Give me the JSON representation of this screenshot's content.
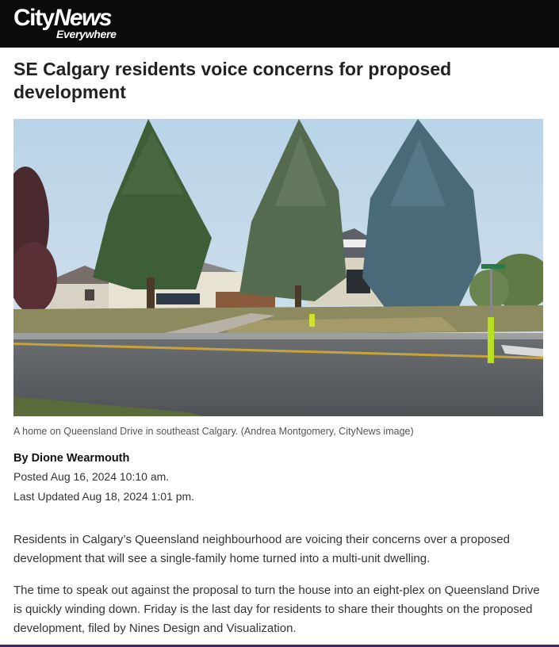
{
  "brand": {
    "name_part1": "City",
    "name_part2": "News",
    "tagline": "Everywhere"
  },
  "article": {
    "headline": "SE Calgary residents voice concerns for proposed development",
    "image_caption": "A home on Queensland Drive in southeast Calgary. (Andrea Montgomery, CityNews image)",
    "byline": "By Dione Wearmouth",
    "posted": "Posted Aug 16, 2024 10:10 am.",
    "updated": "Last Updated Aug 18, 2024 1:01 pm.",
    "paragraphs": [
      "Residents in Calgary’s Queensland neighbourhood are voicing their concerns over a proposed development that will see a single-family home turned into a multi-unit dwelling.",
      "The time to speak out against the proposal to turn the house into an eight-plex on Queensland Drive is quickly winding down. Friday is the last day for residents to share their thoughts on the proposed development, filed by Nines Design and Visualization."
    ]
  },
  "colors": {
    "header_bg": "#0b0b0b",
    "logo_text": "#ffffff",
    "headline_text": "#222222",
    "body_text": "#333333",
    "caption_text": "#555555",
    "bottom_accent": "#3b2a5a"
  }
}
